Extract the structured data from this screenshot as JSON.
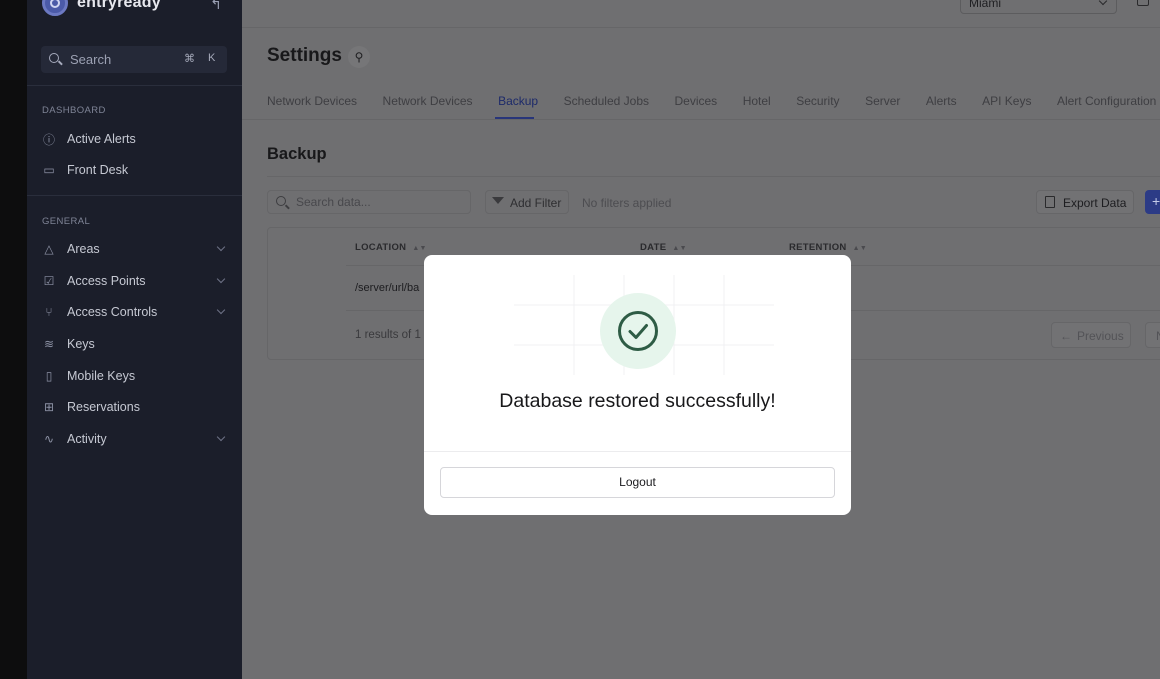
{
  "sidebar": {
    "brand": "entryready",
    "search": {
      "placeholder": "Search",
      "shortcut_cmd": "⌘",
      "shortcut_key": "K"
    },
    "sections": [
      {
        "label": "DASHBOARD",
        "items": [
          {
            "label": "Active Alerts",
            "icon": "alert-circle-icon"
          },
          {
            "label": "Front Desk",
            "icon": "monitor-icon"
          }
        ]
      },
      {
        "label": "GENERAL",
        "items": [
          {
            "label": "Areas",
            "icon": "triangle-icon",
            "expandable": true
          },
          {
            "label": "Access Points",
            "icon": "checkbox-icon",
            "expandable": true
          },
          {
            "label": "Access Controls",
            "icon": "network-icon",
            "expandable": true
          },
          {
            "label": "Keys",
            "icon": "layers-icon"
          },
          {
            "label": "Mobile Keys",
            "icon": "phone-icon"
          },
          {
            "label": "Reservations",
            "icon": "grid-icon"
          },
          {
            "label": "Activity",
            "icon": "activity-icon",
            "expandable": true
          }
        ]
      }
    ]
  },
  "header": {
    "location": "Miami"
  },
  "page": {
    "title": "Settings",
    "tabs": [
      {
        "label": "Network Devices"
      },
      {
        "label": "Network Devices"
      },
      {
        "label": "Backup",
        "active": true
      },
      {
        "label": "Scheduled Jobs"
      },
      {
        "label": "Devices"
      },
      {
        "label": "Hotel"
      },
      {
        "label": "Security"
      },
      {
        "label": "Server"
      },
      {
        "label": "Alerts"
      },
      {
        "label": "API Keys"
      },
      {
        "label": "Alert Configuration"
      }
    ],
    "section_title": "Backup",
    "toolbar": {
      "search_placeholder": "Search data...",
      "add_filter": "Add Filter",
      "no_filters": "No filters applied",
      "export": "Export Data",
      "add": "+"
    },
    "table": {
      "columns": [
        "LOCATION",
        "DATE",
        "RETENTION"
      ],
      "rows": [
        [
          "/server/url/ba",
          "",
          ""
        ]
      ],
      "results_text": "1 results of 1",
      "previous": "Previous",
      "next": "N"
    }
  },
  "modal": {
    "message": "Database restored successfully!",
    "button": "Logout",
    "accent": "#2e5c45"
  },
  "colors": {
    "sidebar_bg": "#1b1e2a",
    "overlay_bg": "#6f6f71",
    "tab_active": "#1d2a6a"
  }
}
